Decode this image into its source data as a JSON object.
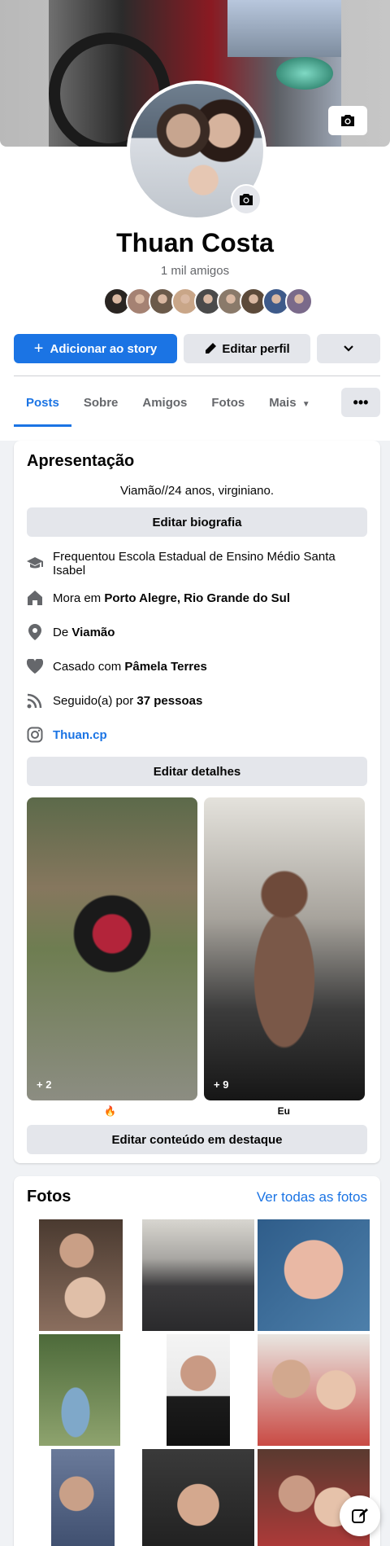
{
  "profile": {
    "name": "Thuan Costa",
    "friends_count": "1 mil amigos",
    "friend_avatar_colors": [
      "#2a2522",
      "#a58273",
      "#6b5a4a",
      "#c9a688",
      "#4a4a4a",
      "#8a7a6a",
      "#5c4a3a",
      "#3e5a8a",
      "#7a6a8a"
    ]
  },
  "actions": {
    "add_story": "Adicionar ao story",
    "edit_profile": "Editar perfil"
  },
  "tabs": [
    "Posts",
    "Sobre",
    "Amigos",
    "Fotos",
    "Mais"
  ],
  "intro": {
    "title": "Apresentação",
    "bio": "Viamão//24 anos, virginiano.",
    "edit_bio": "Editar biografia",
    "items": [
      {
        "icon": "school-icon",
        "prefix": "Frequentou Escola Estadual de Ensino Médio Santa Isabel",
        "bold": ""
      },
      {
        "icon": "home-icon",
        "prefix": "Mora em ",
        "bold": "Porto Alegre, Rio Grande do Sul"
      },
      {
        "icon": "location-pin-icon",
        "prefix": "De ",
        "bold": "Viamão"
      },
      {
        "icon": "heart-icon",
        "prefix": "Casado com ",
        "bold": "Pâmela Terres"
      },
      {
        "icon": "rss-icon",
        "prefix": "Seguido(a) por ",
        "bold": "37 pessoas"
      }
    ],
    "instagram": "Thuan.cp",
    "edit_details": "Editar detalhes",
    "highlights": [
      {
        "count": "+ 2",
        "caption": "🔥"
      },
      {
        "count": "+ 9",
        "caption": "Eu"
      }
    ],
    "edit_highlights": "Editar conteúdo em destaque"
  },
  "photos": {
    "title": "Fotos",
    "see_all": "Ver todas as fotos"
  },
  "colors": {
    "accent": "#1b74e4",
    "secondary_bg": "#e4e6eb",
    "page_bg": "#f0f2f5"
  }
}
